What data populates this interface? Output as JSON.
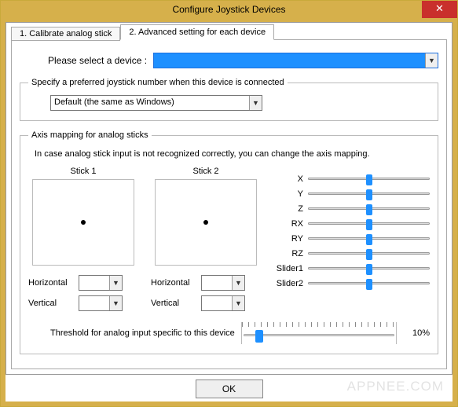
{
  "window": {
    "title": "Configure Joystick Devices",
    "close_glyph": "✕"
  },
  "tabs": [
    {
      "label": "1. Calibrate analog stick"
    },
    {
      "label": "2. Advanced setting for each device"
    }
  ],
  "device_select": {
    "label": "Please select a device :  ",
    "value": ""
  },
  "joynum": {
    "legend": "Specify a preferred joystick number when this device is connected",
    "value": "Default (the same as Windows)"
  },
  "axis": {
    "legend": "Axis mapping for analog sticks",
    "note": "In case analog stick input is not recognized correctly, you can change the axis mapping.",
    "stick1_label": "Stick 1",
    "stick2_label": "Stick 2",
    "h_label": "Horizontal",
    "v_label": "Vertical",
    "stick1_h": "",
    "stick1_v": "",
    "stick2_h": "",
    "stick2_v": "",
    "sliders": [
      {
        "name": "X",
        "pos": 50
      },
      {
        "name": "Y",
        "pos": 50
      },
      {
        "name": "Z",
        "pos": 50
      },
      {
        "name": "RX",
        "pos": 50
      },
      {
        "name": "RY",
        "pos": 50
      },
      {
        "name": "RZ",
        "pos": 50
      },
      {
        "name": "Slider1",
        "pos": 50
      },
      {
        "name": "Slider2",
        "pos": 50
      }
    ],
    "threshold_label": "Threshold for analog input specific to this device",
    "threshold_pct": "10%"
  },
  "ok_label": "OK",
  "watermark": "APPNEE.COM",
  "arrow_glyph": "▼"
}
